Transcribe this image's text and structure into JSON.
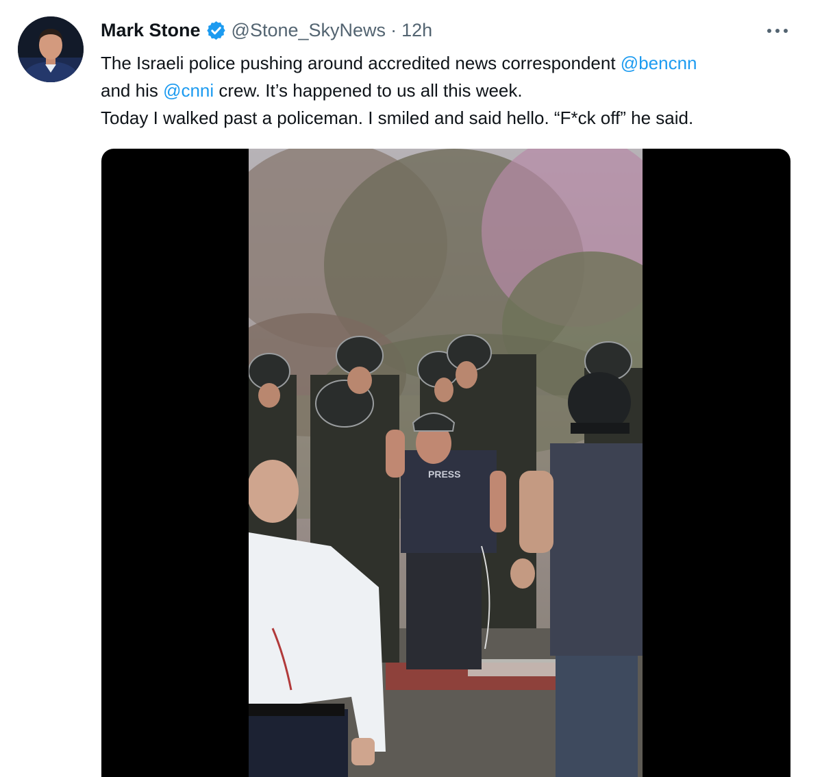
{
  "tweet": {
    "author_name": "Mark Stone",
    "handle": "@Stone_SkyNews",
    "separator": "·",
    "time": "12h",
    "more_label": "•••",
    "verified": true,
    "text": {
      "l1_pre": "The Israeli police pushing around accredited news correspondent ",
      "l1_mention": "@bencnn",
      "l2_pre": "and his ",
      "l2_mention": "@cnni",
      "l2_post": " crew. It’s happened to us all this week.",
      "l3": "Today I walked past a policeman.  I smiled and said hello. “F*ck off” he said."
    },
    "media": {
      "press_vest_text": "PRESS"
    }
  },
  "icons": {
    "verified": "verified-badge-icon",
    "more": "more-options-icon"
  },
  "colors": {
    "link": "#1d9bf0",
    "verified": "#1d9bf0",
    "secondary_text": "#536471",
    "primary_text": "#0f1419",
    "media_background": "#000000"
  }
}
